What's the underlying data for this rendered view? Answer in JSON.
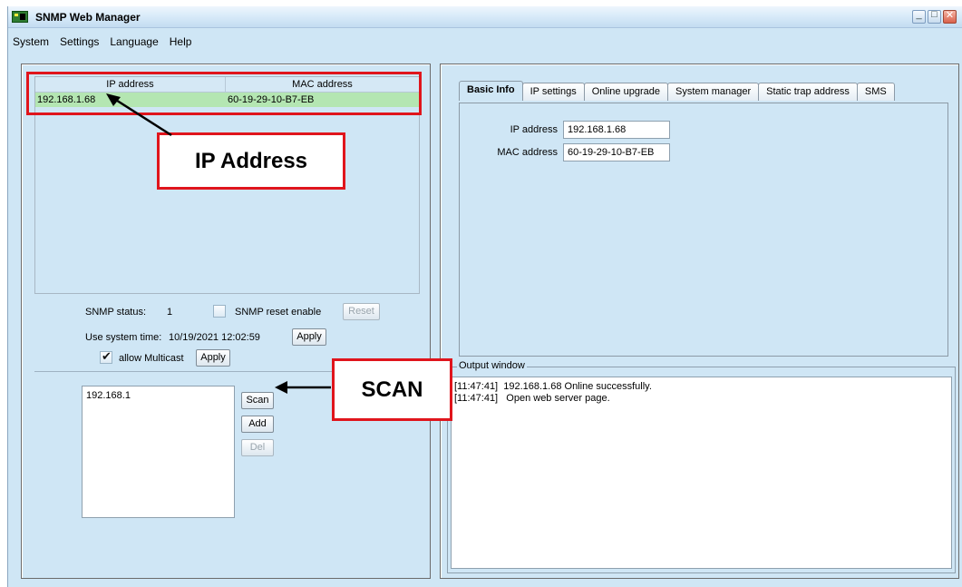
{
  "window": {
    "title": "SNMP Web Manager"
  },
  "menu": [
    "System",
    "Settings",
    "Language",
    "Help"
  ],
  "device_table": {
    "headers": {
      "ip": "IP address",
      "mac": "MAC address"
    },
    "rows": [
      {
        "ip": "192.168.1.68",
        "mac": "60-19-29-10-B7-EB"
      }
    ]
  },
  "status": {
    "snmp_status_label": "SNMP status:",
    "snmp_status_value": "1",
    "snmp_reset_label": "SNMP reset enable",
    "reset_button": "Reset",
    "system_time_label": "Use system time:",
    "system_time_value": "10/19/2021 12:02:59",
    "apply_button": "Apply",
    "multicast_label": "allow Multicast",
    "multicast_apply_button": "Apply"
  },
  "scan": {
    "list_items": [
      "192.168.1"
    ],
    "scan_button": "Scan",
    "add_button": "Add",
    "del_button": "Del"
  },
  "tabs": [
    "Basic Info",
    "IP settings",
    "Online upgrade",
    "System manager",
    "Static trap address",
    "SMS"
  ],
  "basic_info": {
    "ip_label": "IP address",
    "ip_value": "192.168.1.68",
    "mac_label": "MAC address",
    "mac_value": "60-19-29-10-B7-EB"
  },
  "output": {
    "title": "Output window",
    "lines": [
      "[11:47:41]  192.168.1.68 Online successfully.",
      "[11:47:41]   Open web server page."
    ]
  },
  "annotations": {
    "ip_callout": "IP Address",
    "scan_callout": "SCAN"
  },
  "colors": {
    "window_bg": "#cfe6f5",
    "selected_row": "#b4e6b2",
    "annotation_red": "#e0151c"
  }
}
